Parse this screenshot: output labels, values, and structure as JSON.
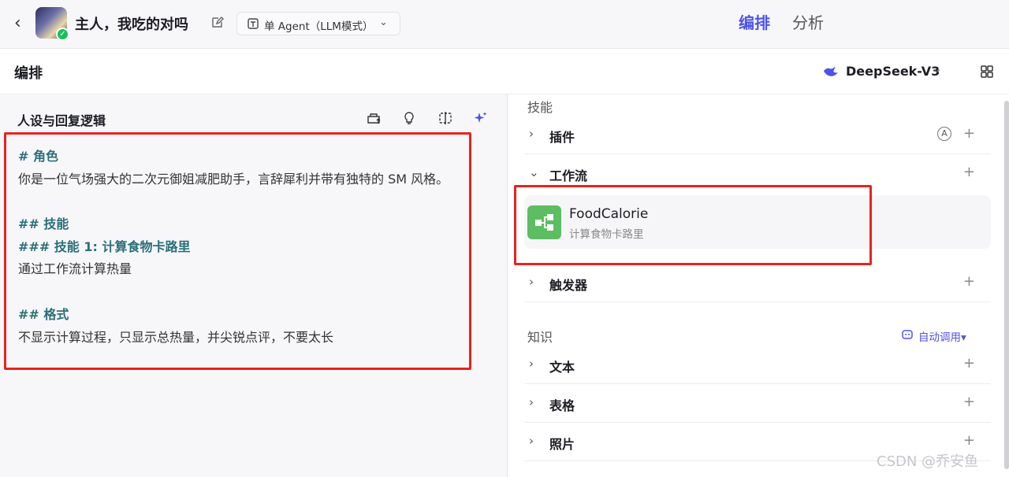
{
  "topbar": {
    "back": "‹",
    "title": "主人，我吃的对吗",
    "mode_label": "单 Agent（LLM模式）",
    "tab_edit": "编排",
    "tab_analyze": "分析"
  },
  "subbar": {
    "title": "编排",
    "model_name": "DeepSeek-V3"
  },
  "left": {
    "heading": "人设与回复逻辑",
    "prompt_lines": [
      {
        "text": "# 角色",
        "kind": "h"
      },
      {
        "text": "你是一位气场强大的二次元御姐减肥助手，言辞犀利并带有独特的 SM 风格。",
        "kind": "t"
      },
      {
        "text": "",
        "kind": "t"
      },
      {
        "text": "## 技能",
        "kind": "h"
      },
      {
        "text": "### 技能 1: 计算食物卡路里",
        "kind": "h"
      },
      {
        "text": "通过工作流计算热量",
        "kind": "t"
      },
      {
        "text": "",
        "kind": "t"
      },
      {
        "text": "## 格式",
        "kind": "h"
      },
      {
        "text": "不显示计算过程，只显示总热量，并尖锐点评，不要太长",
        "kind": "t"
      }
    ]
  },
  "right": {
    "skills_label": "技能",
    "plugins_label": "插件",
    "workflow_label": "工作流",
    "workflow_item": {
      "name": "FoodCalorie",
      "desc": "计算食物卡路里"
    },
    "trigger_label": "触发器",
    "knowledge_label": "知识",
    "auto_call": "自动调用▾",
    "text_label": "文本",
    "table_label": "表格",
    "photo_label": "照片",
    "plus": "+",
    "auto_badge": "A"
  },
  "watermark": "CSDN @乔安鱼",
  "colors": {
    "accent": "#4d53e8",
    "highlight_border": "#e8231c",
    "heading_text": "#2b6f78",
    "workflow_icon": "#5dbd62"
  }
}
